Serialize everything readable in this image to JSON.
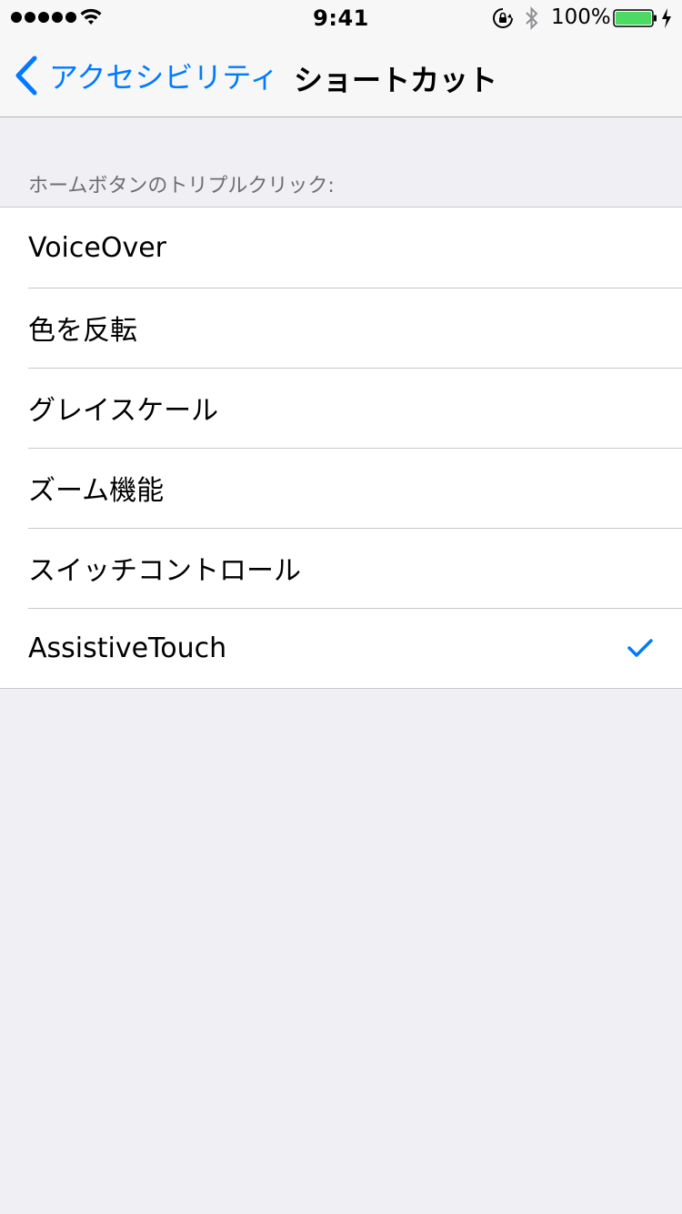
{
  "status_bar": {
    "time": "9:41",
    "battery_percent": "100%",
    "battery_level": 1.0,
    "signal_bars": 5,
    "icons": [
      "signal-dots",
      "wifi-icon",
      "rotation-lock-icon",
      "bluetooth-icon",
      "battery-icon",
      "charging-bolt-icon"
    ]
  },
  "nav": {
    "back_label": "アクセシビリティ",
    "title": "ショートカット"
  },
  "section": {
    "header": "ホームボタンのトリプルクリック:",
    "items": [
      {
        "label": "VoiceOver",
        "checked": false
      },
      {
        "label": "色を反転",
        "checked": false
      },
      {
        "label": "グレイスケール",
        "checked": false
      },
      {
        "label": "ズーム機能",
        "checked": false
      },
      {
        "label": "スイッチコントロール",
        "checked": false
      },
      {
        "label": "AssistiveTouch",
        "checked": true
      }
    ]
  },
  "colors": {
    "accent": "#007aff",
    "battery_fill": "#4cd964",
    "background": "#efeff4",
    "separator": "#c8c7cc"
  }
}
